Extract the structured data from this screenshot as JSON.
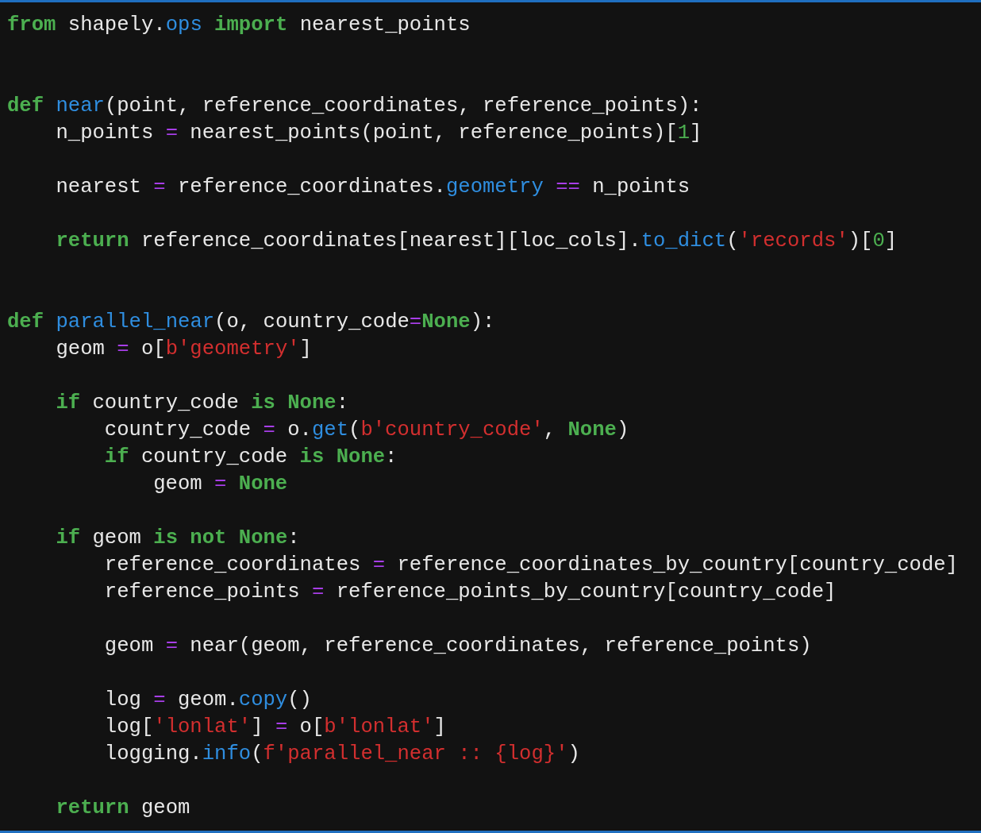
{
  "code_lines": [
    {
      "kind": "code",
      "tokens": [
        {
          "text": "from",
          "kind": "keyword"
        },
        {
          "text": " shapely.",
          "kind": "plain"
        },
        {
          "text": "ops",
          "kind": "function"
        },
        {
          "text": " import ",
          "kind": "keyword"
        },
        {
          "text": "nearest_points",
          "kind": "plain"
        }
      ]
    },
    {
      "kind": "blank"
    },
    {
      "kind": "blank"
    },
    {
      "kind": "code",
      "tokens": [
        {
          "text": "def ",
          "kind": "keyword"
        },
        {
          "text": "near",
          "kind": "function"
        },
        {
          "text": "(point, reference_coordinates, reference_points):",
          "kind": "plain"
        }
      ],
      "children": [
        {
          "kind": "code",
          "tokens": [
            {
              "text": "n_points ",
              "kind": "plain"
            },
            {
              "text": "=",
              "kind": "operator"
            },
            {
              "text": " nearest_points(point, reference_points)[",
              "kind": "plain"
            },
            {
              "text": "1",
              "kind": "number"
            },
            {
              "text": "]",
              "kind": "plain"
            }
          ]
        },
        {
          "kind": "blank"
        },
        {
          "kind": "code",
          "tokens": [
            {
              "text": "nearest ",
              "kind": "plain"
            },
            {
              "text": "=",
              "kind": "operator"
            },
            {
              "text": " reference_coordinates.",
              "kind": "plain"
            },
            {
              "text": "geometry ",
              "kind": "function"
            },
            {
              "text": "==",
              "kind": "operator"
            },
            {
              "text": " n_points",
              "kind": "plain"
            }
          ]
        },
        {
          "kind": "blank"
        },
        {
          "kind": "code",
          "tokens": [
            {
              "text": "return ",
              "kind": "keyword"
            },
            {
              "text": "reference_coordinates[nearest][loc_cols].",
              "kind": "plain"
            },
            {
              "text": "to_dict",
              "kind": "function"
            },
            {
              "text": "(",
              "kind": "plain"
            },
            {
              "text": "'records'",
              "kind": "string"
            },
            {
              "text": ")[",
              "kind": "plain"
            },
            {
              "text": "0",
              "kind": "number"
            },
            {
              "text": "]",
              "kind": "plain"
            }
          ]
        },
        {
          "kind": "blank"
        },
        {
          "kind": "blank"
        }
      ]
    },
    {
      "kind": "code",
      "tokens": [
        {
          "text": "def ",
          "kind": "keyword"
        },
        {
          "text": "parallel_near",
          "kind": "function"
        },
        {
          "text": "(o, country_code",
          "kind": "plain"
        },
        {
          "text": "=",
          "kind": "operator"
        },
        {
          "text": "None",
          "kind": "keyword"
        },
        {
          "text": "):",
          "kind": "plain"
        }
      ],
      "children": [
        {
          "kind": "code",
          "tokens": [
            {
              "text": "geom ",
              "kind": "plain"
            },
            {
              "text": "=",
              "kind": "operator"
            },
            {
              "text": " o[",
              "kind": "plain"
            },
            {
              "text": "b'geometry'",
              "kind": "string"
            },
            {
              "text": "]",
              "kind": "plain"
            }
          ]
        },
        {
          "kind": "blank"
        },
        {
          "kind": "code",
          "tokens": [
            {
              "text": "if ",
              "kind": "keyword"
            },
            {
              "text": "country_code ",
              "kind": "plain"
            },
            {
              "text": "is None",
              "kind": "keyword"
            },
            {
              "text": ":",
              "kind": "plain"
            }
          ],
          "children": [
            {
              "kind": "code",
              "tokens": [
                {
                  "text": "country_code ",
                  "kind": "plain"
                },
                {
                  "text": "=",
                  "kind": "operator"
                },
                {
                  "text": " o.",
                  "kind": "plain"
                },
                {
                  "text": "get",
                  "kind": "function"
                },
                {
                  "text": "(",
                  "kind": "plain"
                },
                {
                  "text": "b'country_code'",
                  "kind": "string"
                },
                {
                  "text": ", ",
                  "kind": "plain"
                },
                {
                  "text": "None",
                  "kind": "keyword"
                },
                {
                  "text": ")",
                  "kind": "plain"
                }
              ]
            },
            {
              "kind": "code",
              "tokens": [
                {
                  "text": "if ",
                  "kind": "keyword"
                },
                {
                  "text": "country_code ",
                  "kind": "plain"
                },
                {
                  "text": "is None",
                  "kind": "keyword"
                },
                {
                  "text": ":",
                  "kind": "plain"
                }
              ],
              "children": [
                {
                  "kind": "code",
                  "tokens": [
                    {
                      "text": "geom ",
                      "kind": "plain"
                    },
                    {
                      "text": "= ",
                      "kind": "operator"
                    },
                    {
                      "text": "None",
                      "kind": "keyword"
                    }
                  ]
                }
              ]
            }
          ]
        },
        {
          "kind": "blank"
        },
        {
          "kind": "code",
          "tokens": [
            {
              "text": "if ",
              "kind": "keyword"
            },
            {
              "text": "geom ",
              "kind": "plain"
            },
            {
              "text": "is not None",
              "kind": "keyword"
            },
            {
              "text": ":",
              "kind": "plain"
            }
          ],
          "children": [
            {
              "kind": "code",
              "tokens": [
                {
                  "text": "reference_coordinates ",
                  "kind": "plain"
                },
                {
                  "text": "=",
                  "kind": "operator"
                },
                {
                  "text": " reference_coordinates_by_country[country_code]",
                  "kind": "plain"
                }
              ]
            },
            {
              "kind": "code",
              "tokens": [
                {
                  "text": "reference_points ",
                  "kind": "plain"
                },
                {
                  "text": "=",
                  "kind": "operator"
                },
                {
                  "text": " reference_points_by_country[country_code]",
                  "kind": "plain"
                }
              ]
            },
            {
              "kind": "blank"
            },
            {
              "kind": "code",
              "tokens": [
                {
                  "text": "geom ",
                  "kind": "plain"
                },
                {
                  "text": "=",
                  "kind": "operator"
                },
                {
                  "text": " near(geom, reference_coordinates, reference_points)",
                  "kind": "plain"
                }
              ]
            },
            {
              "kind": "blank"
            },
            {
              "kind": "code",
              "tokens": [
                {
                  "text": "log ",
                  "kind": "plain"
                },
                {
                  "text": "=",
                  "kind": "operator"
                },
                {
                  "text": " geom.",
                  "kind": "plain"
                },
                {
                  "text": "copy",
                  "kind": "function"
                },
                {
                  "text": "()",
                  "kind": "plain"
                }
              ]
            },
            {
              "kind": "code",
              "tokens": [
                {
                  "text": "log[",
                  "kind": "plain"
                },
                {
                  "text": "'lonlat'",
                  "kind": "string"
                },
                {
                  "text": "] ",
                  "kind": "plain"
                },
                {
                  "text": "=",
                  "kind": "operator"
                },
                {
                  "text": " o[",
                  "kind": "plain"
                },
                {
                  "text": "b'lonlat'",
                  "kind": "string"
                },
                {
                  "text": "]",
                  "kind": "plain"
                }
              ]
            },
            {
              "kind": "code",
              "tokens": [
                {
                  "text": "logging.",
                  "kind": "plain"
                },
                {
                  "text": "info",
                  "kind": "function"
                },
                {
                  "text": "(",
                  "kind": "plain"
                },
                {
                  "text": "f'parallel_near :: {log}'",
                  "kind": "string"
                },
                {
                  "text": ")",
                  "kind": "plain"
                }
              ]
            }
          ]
        },
        {
          "kind": "blank"
        },
        {
          "kind": "code",
          "tokens": [
            {
              "text": "return ",
              "kind": "keyword"
            },
            {
              "text": "geom",
              "kind": "plain"
            }
          ]
        }
      ]
    }
  ]
}
